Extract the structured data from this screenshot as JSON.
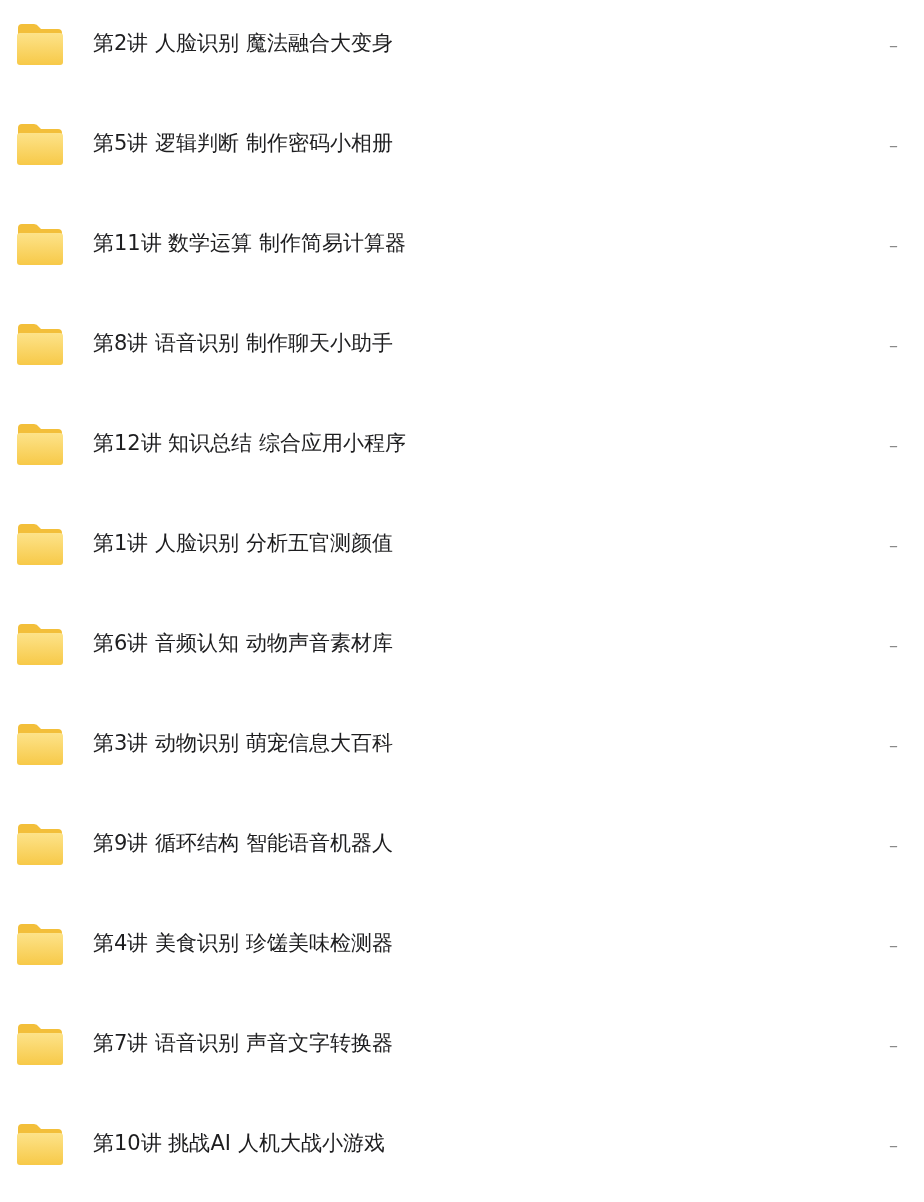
{
  "files": [
    {
      "name": "第2讲 人脸识别 魔法融合大变身",
      "column_2": "–"
    },
    {
      "name": "第5讲 逻辑判断 制作密码小相册",
      "column_2": "–"
    },
    {
      "name": "第11讲 数学运算 制作简易计算器",
      "column_2": "–"
    },
    {
      "name": "第8讲 语音识别 制作聊天小助手",
      "column_2": "–"
    },
    {
      "name": "第12讲 知识总结 综合应用小程序",
      "column_2": "–"
    },
    {
      "name": "第1讲 人脸识别 分析五官测颜值",
      "column_2": "–"
    },
    {
      "name": "第6讲 音频认知 动物声音素材库",
      "column_2": "–"
    },
    {
      "name": "第3讲 动物识别 萌宠信息大百科",
      "column_2": "–"
    },
    {
      "name": "第9讲 循环结构 智能语音机器人",
      "column_2": "–"
    },
    {
      "name": "第4讲 美食识别 珍馐美味检测器",
      "column_2": "–"
    },
    {
      "name": "第7讲 语音识别 声音文字转换器",
      "column_2": "–"
    },
    {
      "name": "第10讲 挑战AI 人机大战小游戏",
      "column_2": "–"
    }
  ]
}
